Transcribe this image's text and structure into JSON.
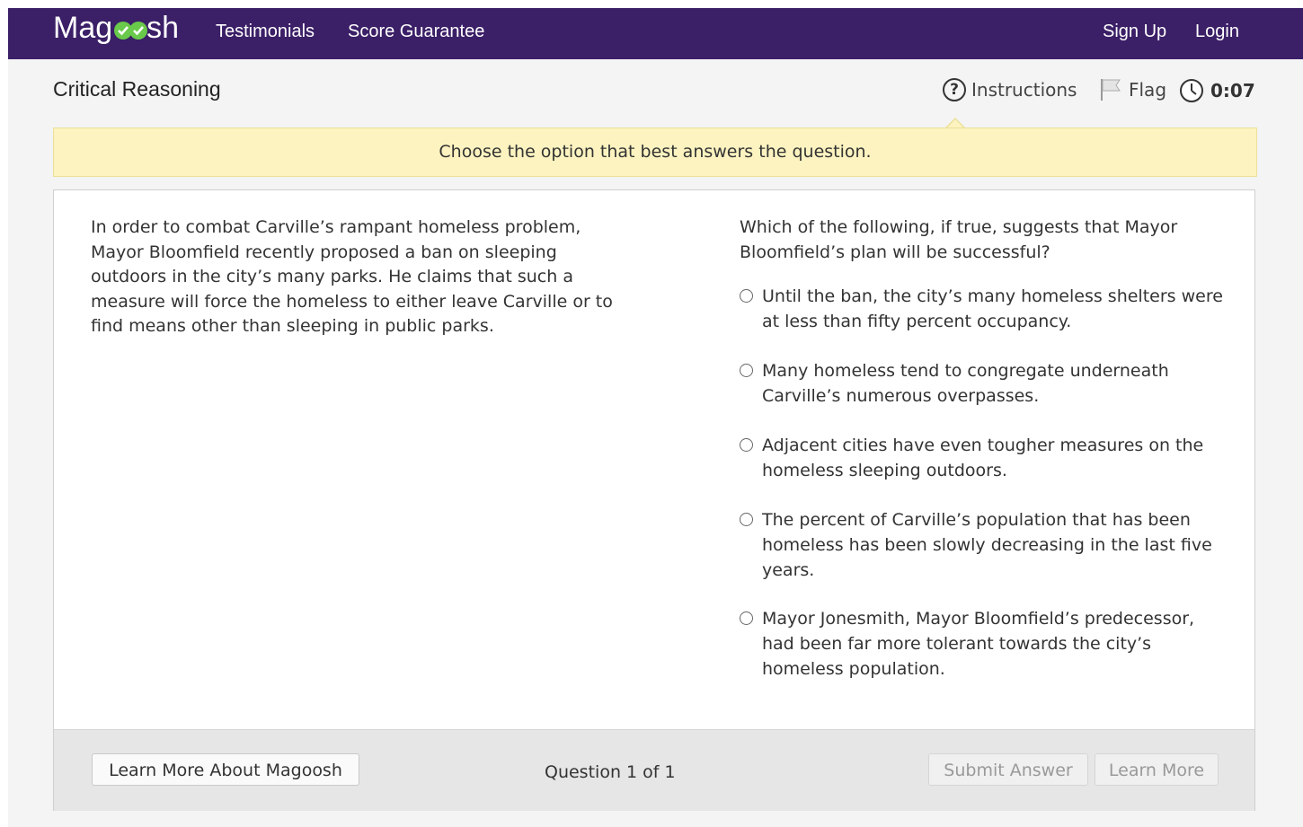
{
  "nav": {
    "logo_pre": "Mag",
    "logo_post": "sh",
    "links": [
      "Testimonials",
      "Score Guarantee"
    ],
    "sign_up": "Sign Up",
    "login": "Login"
  },
  "header": {
    "section_title": "Critical Reasoning",
    "instructions_label": "Instructions",
    "flag_label": "Flag",
    "timer": "0:07"
  },
  "instruction_text": "Choose the option that best answers the question.",
  "question": {
    "passage": "In order to combat Carville’s rampant homeless problem, Mayor Bloomfield recently proposed a ban on sleeping outdoors in the city’s many parks. He claims that such a measure will force the homeless to either leave Carville or to find means other than sleeping in public parks.",
    "stem": "Which of the following, if true, suggests that Mayor Bloomfield’s plan will be successful?",
    "choices": [
      "Until the ban, the city’s many homeless shelters were at less than fifty percent occupancy.",
      "Many homeless tend to congregate underneath Carville’s numerous overpasses.",
      "Adjacent cities have even tougher measures on the homeless sleeping outdoors.",
      "The percent of Carville’s population that has been homeless has been slowly decreasing in the last five years.",
      "Mayor Jonesmith, Mayor Bloomfield’s predecessor, had been far more tolerant towards the city’s homeless population."
    ]
  },
  "footer": {
    "learn_more_about": "Learn More About Magoosh",
    "question_count": "Question 1 of 1",
    "submit": "Submit Answer",
    "learn_more": "Learn More"
  },
  "colors": {
    "nav_bg": "#3b1f67",
    "logo_check": "#69c94a",
    "instruction_bg": "#fcf3c0"
  }
}
